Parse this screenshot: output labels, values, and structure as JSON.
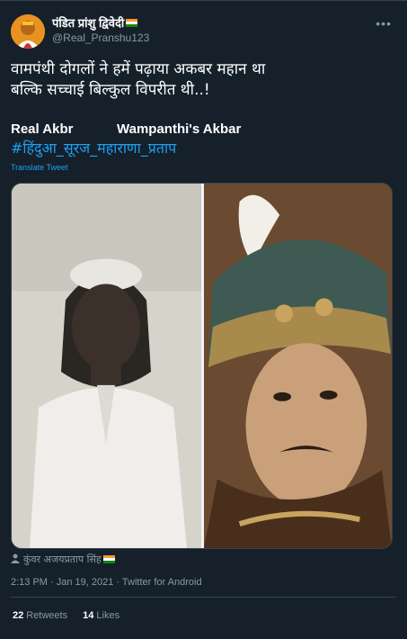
{
  "user": {
    "display_name": "पंडित प्रांशु द्विवेदी",
    "handle": "@Real_Pranshu123"
  },
  "tweet": {
    "line1": "वामपंथी दोगलों ने हमें पढ़ाया अकबर महान था",
    "line2": "बल्कि सच्चाई बिल्कुल विपरीत थी..!",
    "label_left": "Real Akbr",
    "label_right": "Wampanthi's Akbar",
    "hashtag": "#हिंदुआ_सूरज_महाराणा_प्रताप",
    "translate": "Translate Tweet"
  },
  "media": {
    "credit": "कुंवर अजयप्रताप सिंह"
  },
  "meta": {
    "timestamp": "2:13 PM · Jan 19, 2021 · Twitter for Android"
  },
  "stats": {
    "retweets_count": "22",
    "retweets_label": "Retweets",
    "likes_count": "14",
    "likes_label": "Likes"
  },
  "colors": {
    "background": "#15202b",
    "link": "#1da1f2",
    "muted": "#8899a6",
    "border": "#38444d"
  },
  "icons": {
    "more": "more-horizontal-icon",
    "credit": "person-icon",
    "flag": "india-flag-icon"
  }
}
